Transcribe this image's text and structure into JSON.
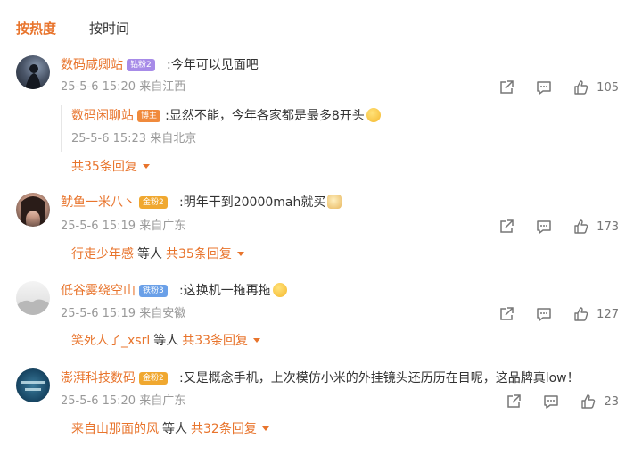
{
  "tabs": {
    "hot": "按热度",
    "time": "按时间"
  },
  "comments": [
    {
      "author": "数码咸卿站",
      "badge": "钻粉2",
      "text": ":今年可以见面吧",
      "meta": "25-5-6 15:20 来自江西",
      "likes": "105",
      "reply": {
        "author": "数码闲聊站",
        "badge": "博主",
        "text": ":显然不能，今年各家都是最多8开头",
        "meta": "25-5-6 15:23 来自北京"
      },
      "more_total": "共35条回复"
    },
    {
      "author": "鱿鱼一米八丶",
      "badge": "金粉2",
      "text": ":明年干到20000mah就买",
      "meta": "25-5-6 15:19 来自广东",
      "likes": "173",
      "more_who": "行走少年感",
      "more_etc": "等人",
      "more_total": "共35条回复"
    },
    {
      "author": "低谷雾绕空山",
      "badge": "铁粉3",
      "text": ":这换机一拖再拖",
      "meta": "25-5-6 15:19 来自安徽",
      "likes": "127",
      "more_who": "笑死人了_xsrl",
      "more_etc": "等人",
      "more_total": "共33条回复"
    },
    {
      "author": "澎湃科技数码",
      "badge": "金粉2",
      "text": ":又是概念手机，上次模仿小米的外挂镜头还历历在目呢，这品牌真low！",
      "meta": "25-5-6 15:20 来自广东",
      "likes": "23",
      "more_who": "来自山那面的风",
      "more_etc": "等人",
      "more_total": "共32条回复"
    }
  ],
  "colors": {
    "accent": "#e8742c",
    "badge_diamond": "#a78be8",
    "badge_gold": "#f0a830",
    "badge_iron": "#6aa0e8",
    "badge_blogger": "#f08a3c"
  }
}
